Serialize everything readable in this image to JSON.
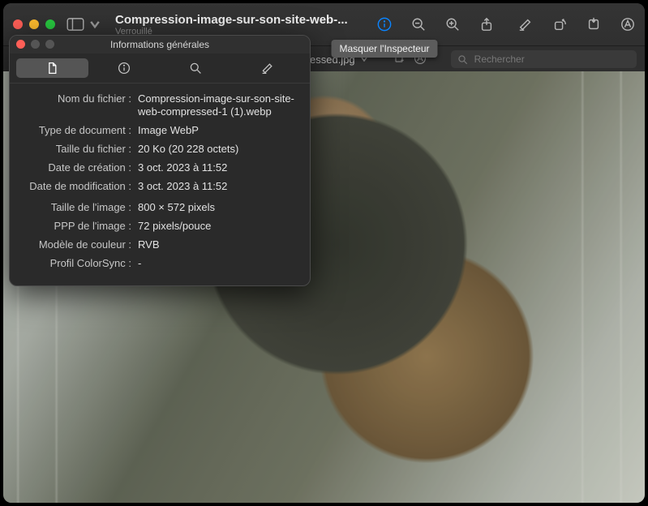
{
  "window": {
    "title": "Compression-image-sur-son-site-web-...",
    "subtitle": "Verrouillé"
  },
  "toolbar": {
    "tooltip_inspector": "Masquer l'Inspecteur"
  },
  "secondbar": {
    "filename": "essed.jpg",
    "search_placeholder": "Rechercher"
  },
  "inspector": {
    "title": "Informations générales",
    "rows_a": [
      {
        "k": "Nom du fichier :",
        "v": "Compression-image-sur-son-site-web-compressed-1 (1).webp"
      },
      {
        "k": "Type de document :",
        "v": "Image WebP"
      },
      {
        "k": "Taille du fichier :",
        "v": "20 Ko (20 228 octets)"
      },
      {
        "k": "Date de création :",
        "v": "3 oct. 2023 à 11:52"
      },
      {
        "k": "Date de modification :",
        "v": "3 oct. 2023 à 11:52"
      }
    ],
    "rows_b": [
      {
        "k": "Taille de l'image :",
        "v": "800 × 572 pixels"
      },
      {
        "k": "PPP de l'image :",
        "v": "72 pixels/pouce"
      },
      {
        "k": "Modèle de couleur :",
        "v": "RVB"
      },
      {
        "k": "Profil ColorSync :",
        "v": "-"
      }
    ]
  }
}
